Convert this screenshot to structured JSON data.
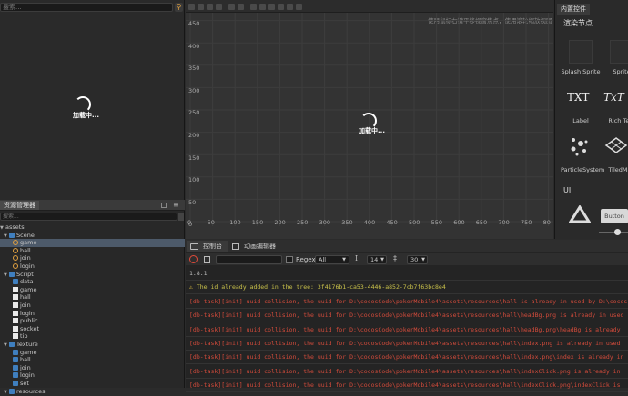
{
  "hierarchy": {
    "search_placeholder": "搜索...",
    "loading_label": "加载中..."
  },
  "assets": {
    "title": "资源管理器",
    "search_placeholder": "搜索...",
    "tree": [
      {
        "label": "assets",
        "depth": 0,
        "kind": "root"
      },
      {
        "label": "Scene",
        "depth": 1,
        "kind": "folder"
      },
      {
        "label": "game",
        "depth": 2,
        "kind": "scene",
        "selected": true
      },
      {
        "label": "hall",
        "depth": 2,
        "kind": "scene"
      },
      {
        "label": "join",
        "depth": 2,
        "kind": "scene"
      },
      {
        "label": "login",
        "depth": 2,
        "kind": "scene"
      },
      {
        "label": "Script",
        "depth": 1,
        "kind": "folder"
      },
      {
        "label": "data",
        "depth": 2,
        "kind": "folder"
      },
      {
        "label": "game",
        "depth": 2,
        "kind": "js"
      },
      {
        "label": "hall",
        "depth": 2,
        "kind": "js"
      },
      {
        "label": "join",
        "depth": 2,
        "kind": "js"
      },
      {
        "label": "login",
        "depth": 2,
        "kind": "js"
      },
      {
        "label": "public",
        "depth": 2,
        "kind": "js"
      },
      {
        "label": "socket",
        "depth": 2,
        "kind": "js"
      },
      {
        "label": "tip",
        "depth": 2,
        "kind": "js"
      },
      {
        "label": "Texture",
        "depth": 1,
        "kind": "folder"
      },
      {
        "label": "game",
        "depth": 2,
        "kind": "folder"
      },
      {
        "label": "hall",
        "depth": 2,
        "kind": "folder"
      },
      {
        "label": "join",
        "depth": 2,
        "kind": "folder"
      },
      {
        "label": "login",
        "depth": 2,
        "kind": "folder"
      },
      {
        "label": "set",
        "depth": 2,
        "kind": "folder"
      },
      {
        "label": "resources",
        "depth": 1,
        "kind": "folder"
      }
    ]
  },
  "scene": {
    "hint": "使用鼠标右键平移视窗焦点，使用滚轮缩放视图",
    "loading_label": "加载中...",
    "y_ticks": [
      "450",
      "400",
      "350",
      "300",
      "250",
      "200",
      "150",
      "100",
      "50",
      "0"
    ],
    "x_ticks": [
      "0",
      "50",
      "100",
      "150",
      "200",
      "250",
      "300",
      "350",
      "400",
      "450",
      "500",
      "550",
      "600",
      "650",
      "700",
      "750",
      "80"
    ]
  },
  "library": {
    "tab": "内置控件",
    "section_render": "渲染节点",
    "section_ui": "UI",
    "items": [
      {
        "label": "Splash Sprite",
        "icon": "sprite-icon"
      },
      {
        "label": "Sprite",
        "icon": "sprite-icon"
      },
      {
        "label": "Label",
        "icon": "label-icon",
        "glyph": "TXT"
      },
      {
        "label": "Rich Text",
        "icon": "richtext-icon",
        "glyph": "TxT"
      },
      {
        "label": "ParticleSystem",
        "icon": "particle-icon"
      },
      {
        "label": "TiledMap",
        "icon": "tiledmap-icon"
      }
    ],
    "ui_items": [
      {
        "label": "",
        "icon": "layout-triangle-icon"
      },
      {
        "label": "Button",
        "icon": "button-icon"
      }
    ]
  },
  "console": {
    "tabs": [
      {
        "label": "控制台",
        "icon": "console-icon",
        "active": true
      },
      {
        "label": "动画编辑器",
        "icon": "animation-icon",
        "active": false
      }
    ],
    "filter_placeholder": "",
    "regex_label": "Regex",
    "level_value": "All",
    "font_size_value": "14",
    "line_height_value": "30",
    "log_lines": [
      {
        "text": "1.8.1",
        "color": "#bdbdbd",
        "type": "info"
      },
      {
        "text": "The id already added in the tree: 3f4176b1-ca53-4446-a852-7cb7f63bc8e4",
        "color": "#c9c14a",
        "type": "warn"
      },
      {
        "text": "[db-task][init] uuid collision, the uuid for D:\\cocosCode\\pokerMobile4\\assets\\resources\\hall is already in used by D:\\cocos",
        "color": "#d34b3b",
        "type": "error"
      },
      {
        "text": "[db-task][init] uuid collision, the uuid for D:\\cocosCode\\pokerMobile4\\assets\\resources\\hall\\headBg.png is already in used",
        "color": "#d34b3b",
        "type": "error"
      },
      {
        "text": "[db-task][init] uuid collision, the uuid for D:\\cocosCode\\pokerMobile4\\assets\\resources\\hall\\headBg.png\\headBg is already",
        "color": "#d34b3b",
        "type": "error"
      },
      {
        "text": "[db-task][init] uuid collision, the uuid for D:\\cocosCode\\pokerMobile4\\assets\\resources\\hall\\index.png is already in used",
        "color": "#d34b3b",
        "type": "error"
      },
      {
        "text": "[db-task][init] uuid collision, the uuid for D:\\cocosCode\\pokerMobile4\\assets\\resources\\hall\\index.png\\index is already in",
        "color": "#d34b3b",
        "type": "error"
      },
      {
        "text": "[db-task][init] uuid collision, the uuid for D:\\cocosCode\\pokerMobile4\\assets\\resources\\hall\\indexClick.png is already in",
        "color": "#d34b3b",
        "type": "error"
      },
      {
        "text": "[db-task][init] uuid collision, the uuid for D:\\cocosCode\\pokerMobile4\\assets\\resources\\hall\\indexClick.png\\indexClick is",
        "color": "#d34b3b",
        "type": "error"
      }
    ]
  }
}
